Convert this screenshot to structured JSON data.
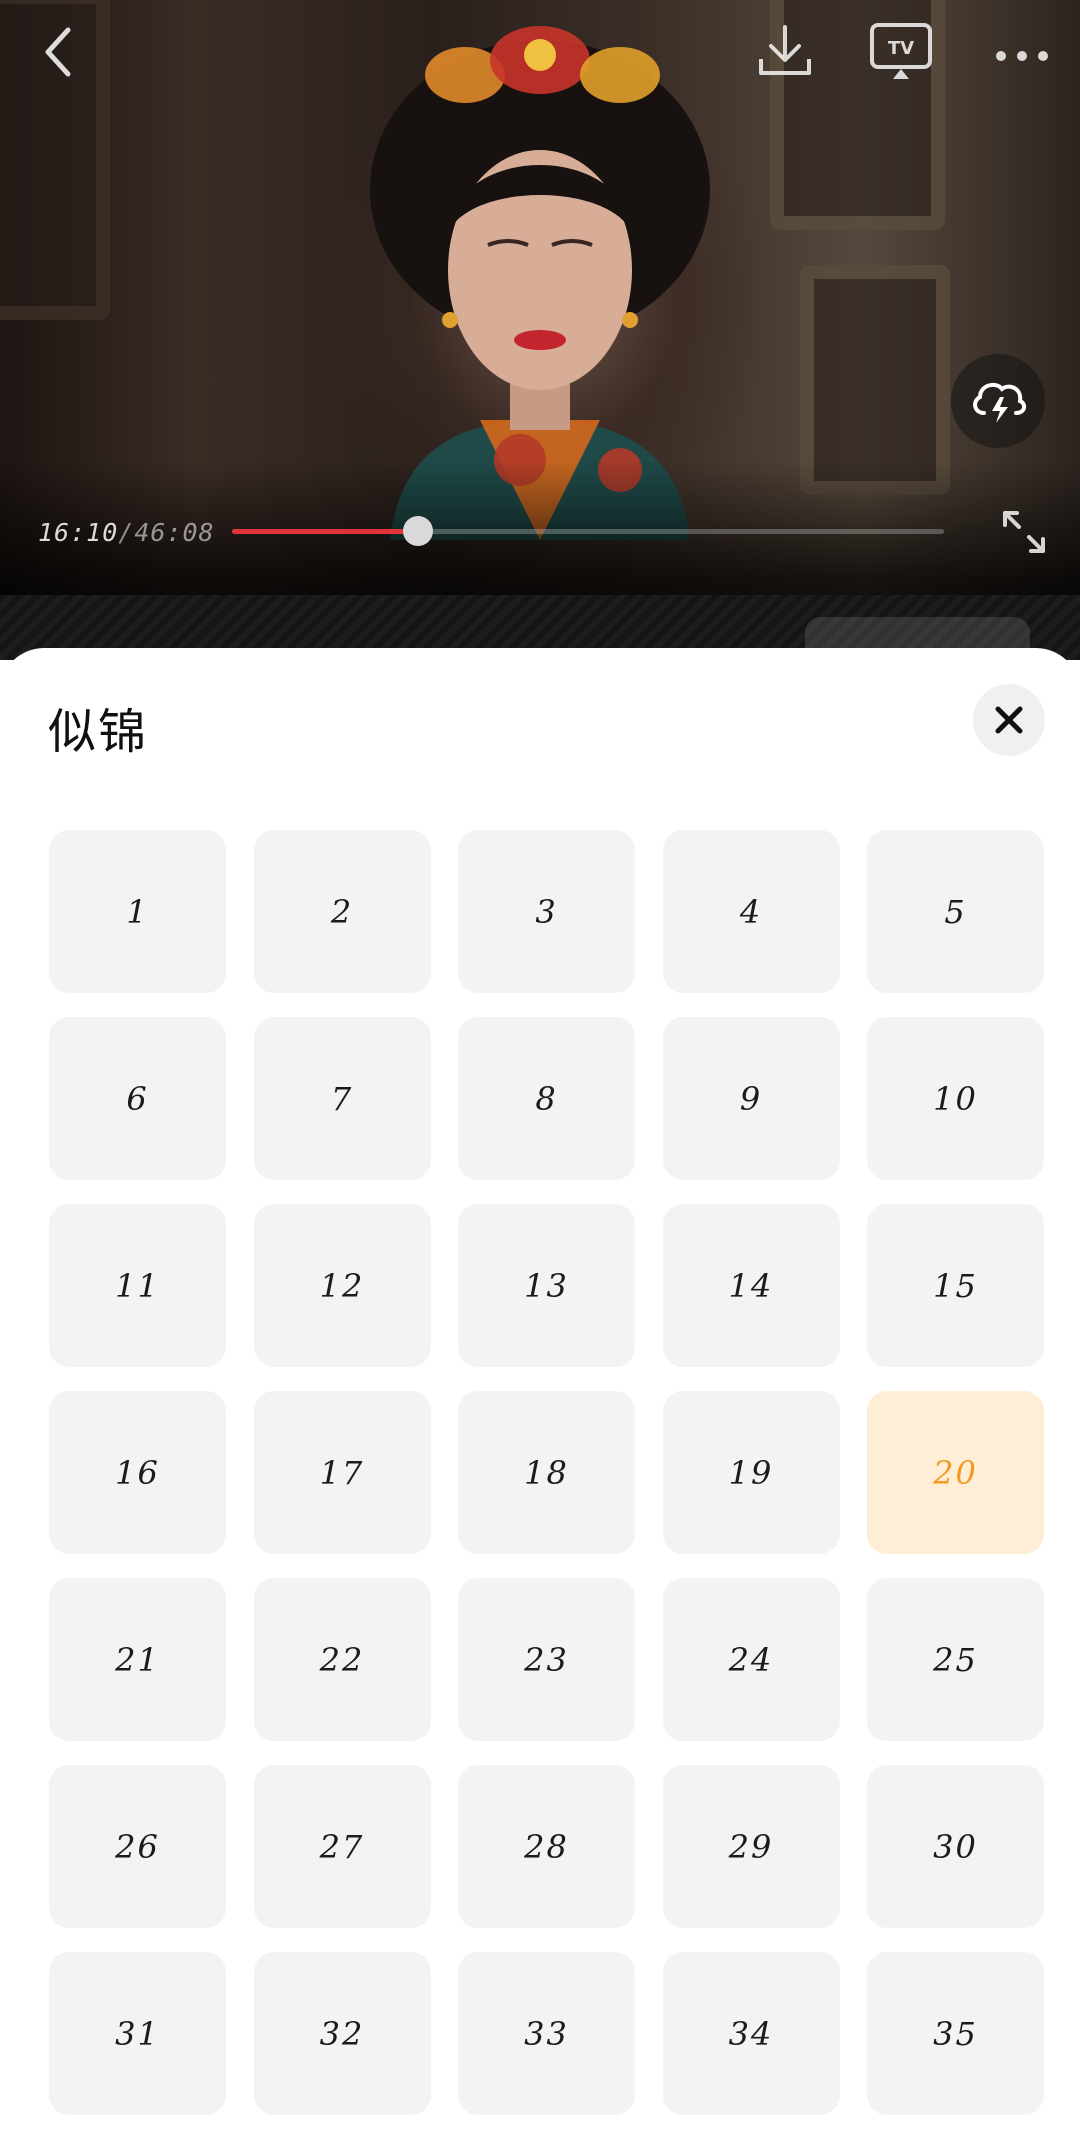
{
  "player": {
    "current_time": "16:10",
    "separator": "/",
    "total_time": "46:08",
    "progress": 0.2616,
    "top_icons": [
      "back-icon",
      "download-icon",
      "tv-cast-icon",
      "more-icon"
    ],
    "side_icon": "cloud-lightning-icon",
    "fullscreen_icon": "fullscreen-icon",
    "accent_color": "#e0343a"
  },
  "sheet": {
    "title": "似锦",
    "close_icon": "close-icon",
    "current_episode": "20",
    "current_color": "#f39a1f",
    "current_bg": "#ffeed6",
    "episodes": [
      "1",
      "2",
      "3",
      "4",
      "5",
      "6",
      "7",
      "8",
      "9",
      "10",
      "11",
      "12",
      "13",
      "14",
      "15",
      "16",
      "17",
      "18",
      "19",
      "20",
      "21",
      "22",
      "23",
      "24",
      "25",
      "26",
      "27",
      "28",
      "29",
      "30",
      "31",
      "32",
      "33",
      "34",
      "35"
    ]
  }
}
